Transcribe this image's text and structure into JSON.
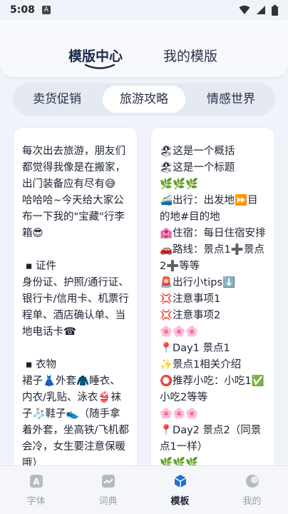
{
  "status": {
    "time": "5:08",
    "badge": "A"
  },
  "header": {
    "tabs": [
      {
        "label": "模版中心"
      },
      {
        "label": "我的模版"
      }
    ]
  },
  "subtabs": [
    {
      "label": "卖货促销"
    },
    {
      "label": "旅游攻略"
    },
    {
      "label": "情感世界"
    }
  ],
  "cards": [
    {
      "text": "每次出去旅游，朋友们都觉得我像是在搬家，出门装备应有尽有😅\n哈哈哈~今天给大家公布一下我的\"宝藏\"行李箱😎\n\n ▪ 证件\n身份证、护照/通行证、银行卡/信用卡、机票行程单、酒店确认单、当地电话卡☎\n\n ▪ 衣物\n裙子👗外套🧥睡衣、内衣/乳贴、泳衣👙袜子🧦鞋子👟（随手拿着外套，坐高铁/飞机都会冷，女生要注意保暖哦）"
    },
    {
      "text": "🏖这是一个概括\n🏖这是一个标题\n🌿🌿🌿\n🚄出行：出发地⏩目的地#目的地\n🏩住宿：每日住宿安排\n🚗路线：景点1➕景点2➕等等\n🚨出行小tips⬇️\n💢注意事项1\n💢注意事项2\n🌸🌸🌸\n📍Day1 景点1\n✨景点1相关介绍\n⭕推荐小吃：小吃1✅小吃2等等\n🌸🌸🌸\n📍Day2 景点2（同景点1一样）\n🌿🌿🌿"
    }
  ],
  "bottom_nav": [
    {
      "label": "字体"
    },
    {
      "label": "词典"
    },
    {
      "label": "模板"
    },
    {
      "label": "我的"
    }
  ],
  "colors": {
    "accent": "#1b2a48",
    "active_icon": "#1f6fd6",
    "inactive": "#9aa0aa"
  }
}
